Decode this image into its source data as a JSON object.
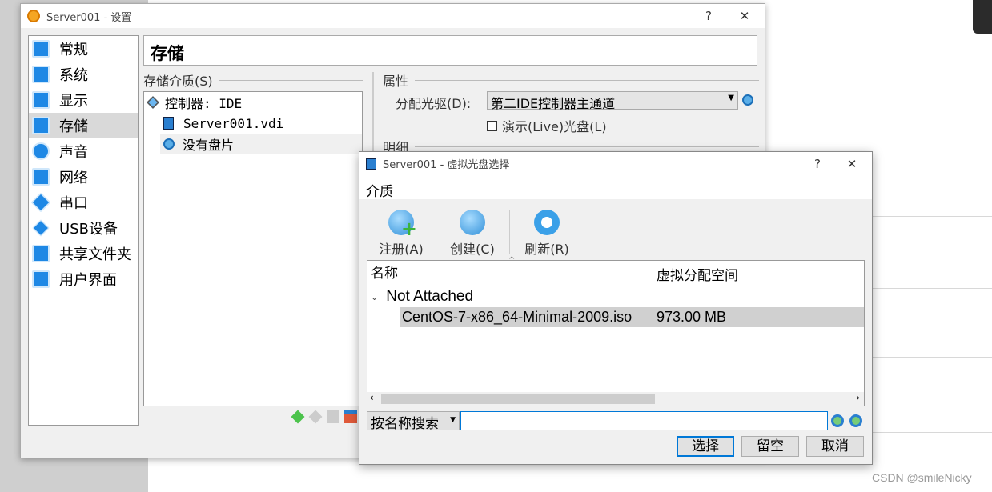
{
  "settings_window": {
    "title": "Server001 - 设置",
    "help": "?",
    "close": "✕",
    "sidebar": [
      {
        "label": "常规"
      },
      {
        "label": "系统"
      },
      {
        "label": "显示"
      },
      {
        "label": "存储",
        "selected": true
      },
      {
        "label": "声音"
      },
      {
        "label": "网络"
      },
      {
        "label": "串口"
      },
      {
        "label": "USB设备"
      },
      {
        "label": "共享文件夹"
      },
      {
        "label": "用户界面"
      }
    ],
    "page_title": "存储",
    "storage_media_label": "存储介质(S)",
    "tree": [
      {
        "label": "控制器: IDE"
      },
      {
        "label": "Server001.vdi"
      },
      {
        "label": "没有盘片"
      }
    ],
    "attributes_label": "属性",
    "optical_drive_label": "分配光驱(D):",
    "optical_drive_value": "第二IDE控制器主通道",
    "live_cd_label": "演示(Live)光盘(L)",
    "live_cd_checked": false,
    "details_label": "明细"
  },
  "dialog": {
    "title": "Server001 - 虚拟光盘选择",
    "help": "?",
    "close": "✕",
    "menu": "介质",
    "toolbar": {
      "add": "注册(A)",
      "create": "创建(C)",
      "refresh": "刷新(R)"
    },
    "columns": [
      "名称",
      "虚拟分配空间"
    ],
    "group": "Not Attached",
    "rows": [
      {
        "name": "CentOS-7-x86_64-Minimal-2009.iso",
        "size": "973.00 MB"
      }
    ],
    "search_mode": "按名称搜索",
    "search_value": "",
    "buttons": {
      "choose": "选择",
      "leave_empty": "留空",
      "cancel": "取消"
    }
  },
  "watermark": "CSDN @smileNicky"
}
